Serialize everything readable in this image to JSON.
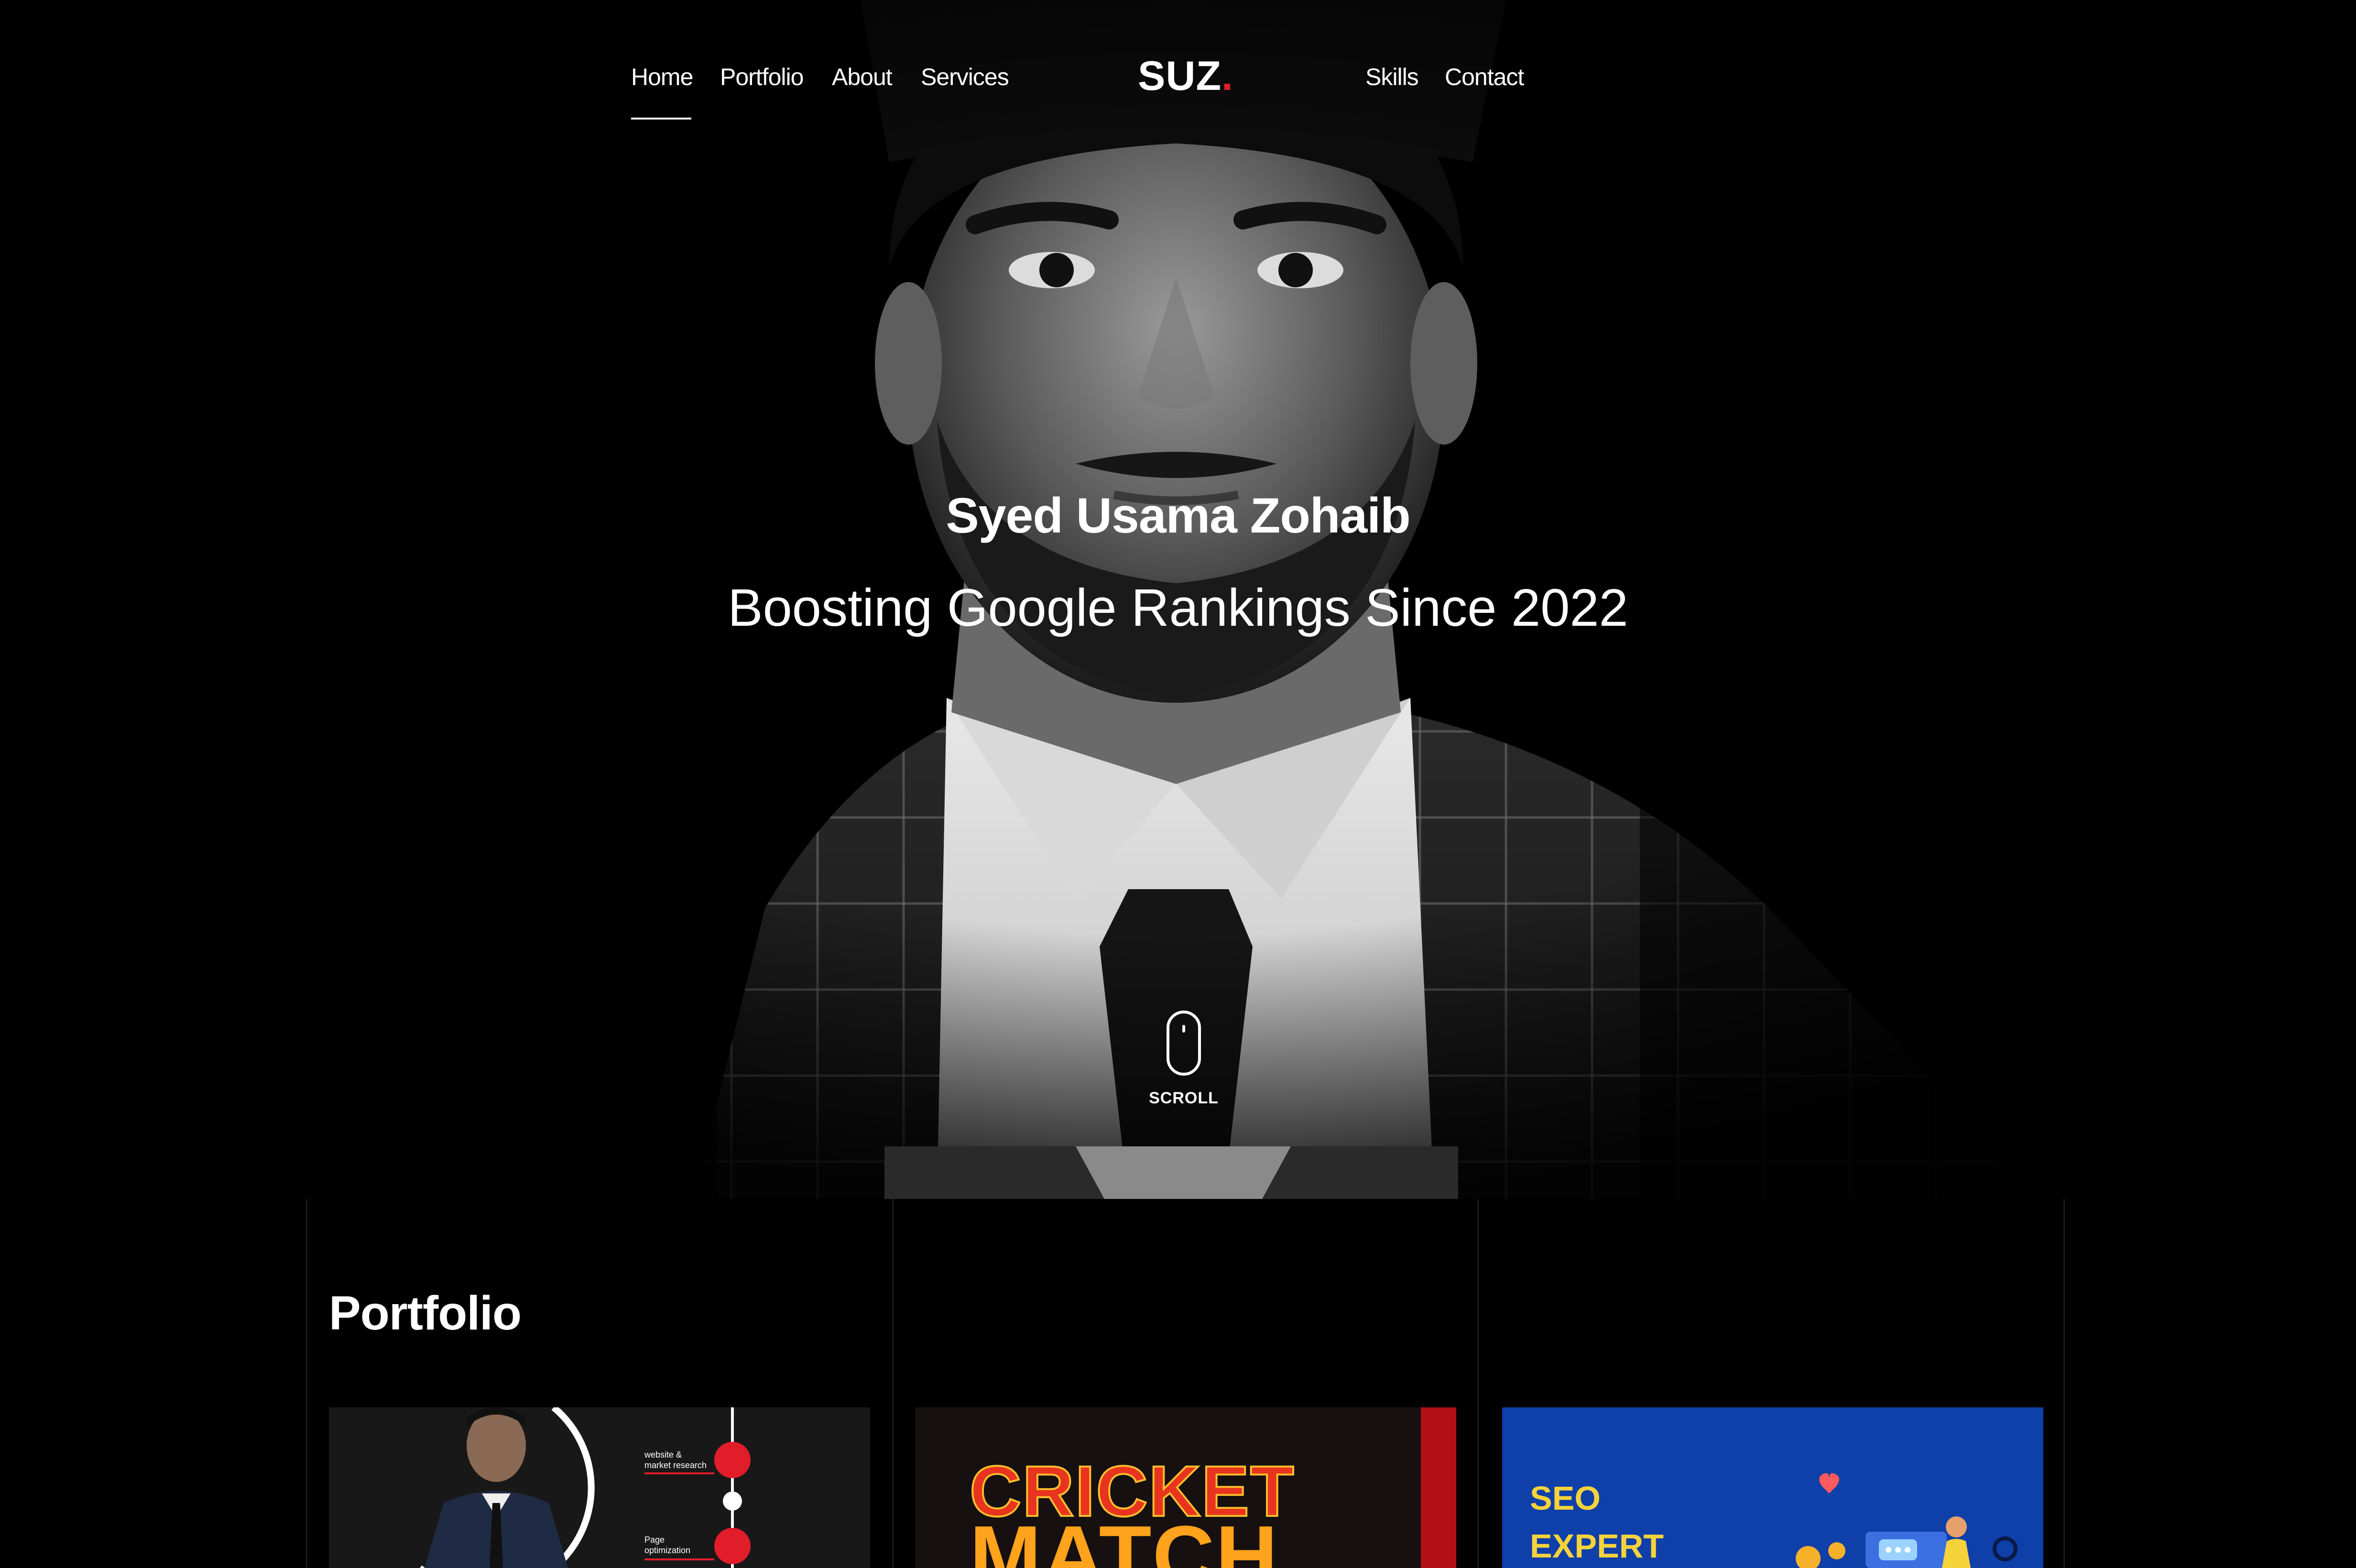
{
  "nav": {
    "left_links": [
      "Home",
      "Portfolio",
      "About",
      "Services"
    ],
    "right_links": [
      "Skills",
      "Contact"
    ],
    "active": "Home",
    "logo": {
      "text": "SUZ",
      "dot": "."
    }
  },
  "hero": {
    "name": "Syed Usama Zohaib",
    "tagline": "Boosting Google Rankings Since 2022",
    "scroll_label": "SCROLL"
  },
  "portfolio": {
    "title": "Portfolio",
    "cards": [
      {
        "labels": [
          "website &",
          "market research",
          "Page",
          "optimization"
        ]
      },
      {
        "title_lines": [
          "CRICKET",
          "MATCH"
        ]
      },
      {
        "title_lines": [
          "SEO",
          "EXPERT"
        ]
      }
    ]
  },
  "colors": {
    "accent": "#e11d2a",
    "background": "#000000",
    "seo_card_bg": "#0f3fa8",
    "seo_text": "#f6d33b"
  }
}
